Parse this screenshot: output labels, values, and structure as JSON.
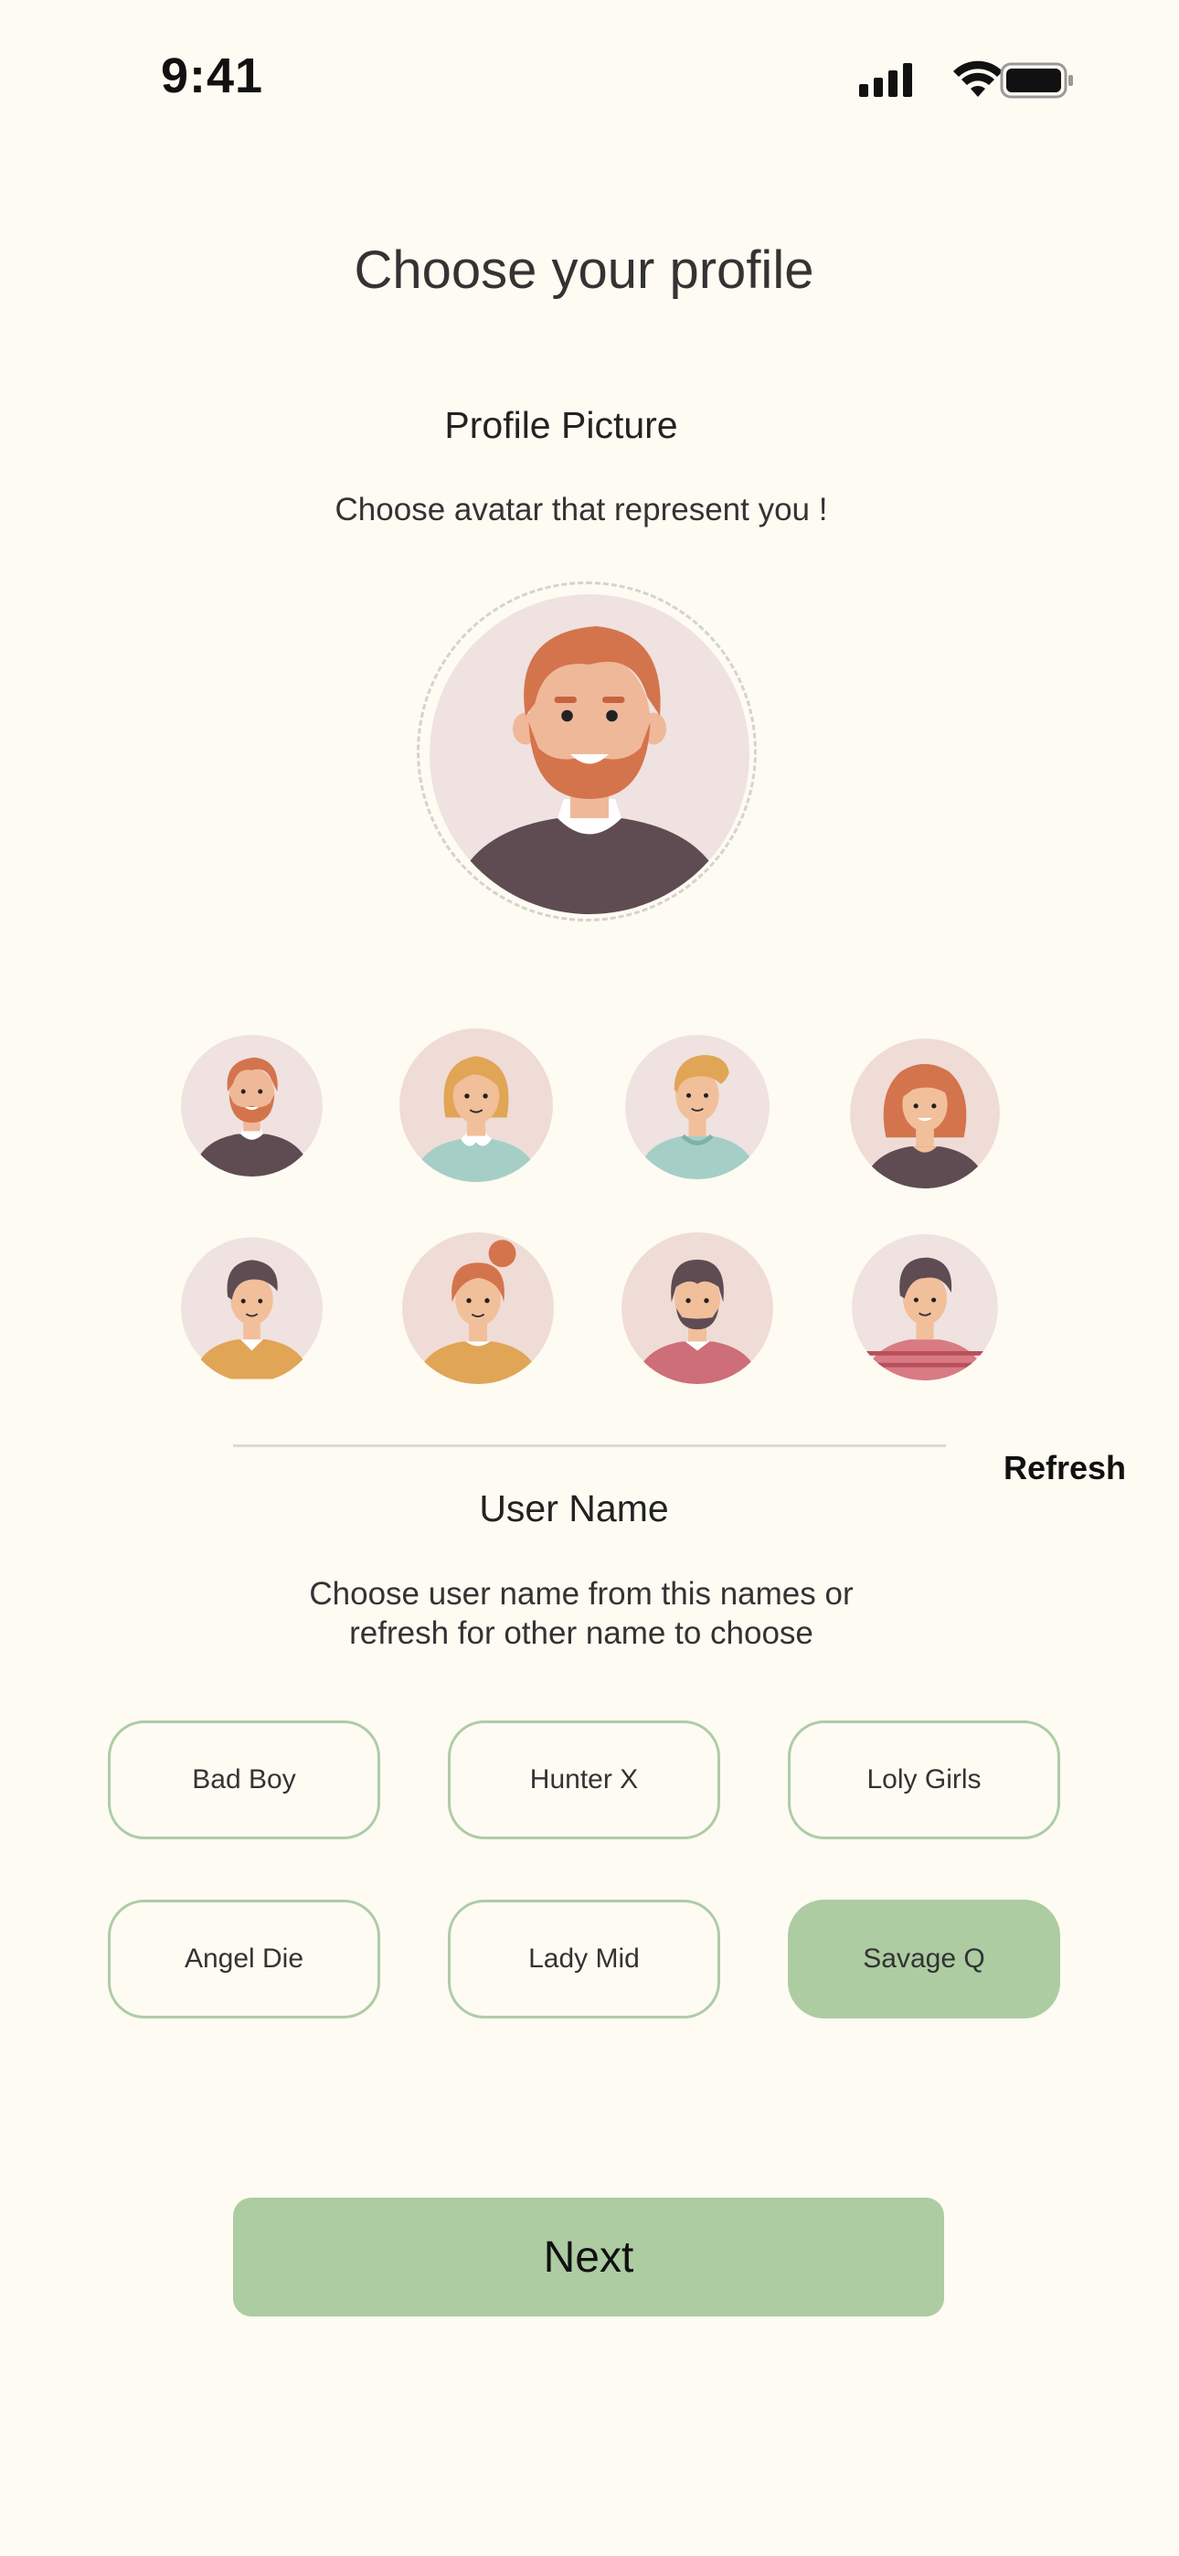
{
  "status_bar": {
    "time": "9:41"
  },
  "header": {
    "title": "Choose your profile"
  },
  "profile_picture": {
    "title": "Profile Picture",
    "subtitle": "Choose avatar that represent you !"
  },
  "avatars": [
    {
      "name": "bearded-man"
    },
    {
      "name": "blonde-girl"
    },
    {
      "name": "blond-boy"
    },
    {
      "name": "redhead-woman"
    },
    {
      "name": "dark-hair-man"
    },
    {
      "name": "bun-girl"
    },
    {
      "name": "bangs-woman"
    },
    {
      "name": "striped-shirt-man"
    }
  ],
  "user_name": {
    "refresh_label": "Refresh",
    "title": "User Name",
    "subtitle_line1": "Choose user name from this names or",
    "subtitle_line2": "refresh for other name to choose",
    "options": [
      "Bad Boy",
      "Hunter X",
      "Loly Girls",
      "Angel Die",
      "Lady Mid",
      "Savage Q"
    ],
    "selected": "Savage Q"
  },
  "footer": {
    "next_label": "Next"
  },
  "colors": {
    "background": "#fdfbf2",
    "accent": "#adcca2",
    "chip_border": "#aecca6"
  }
}
